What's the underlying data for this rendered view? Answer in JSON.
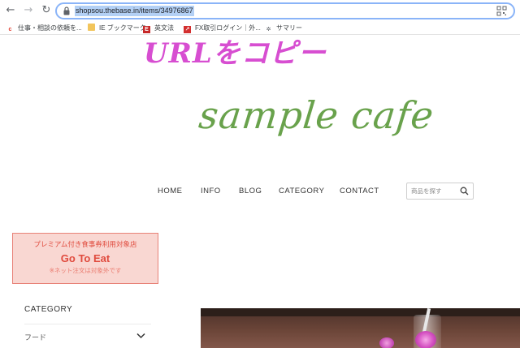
{
  "browser": {
    "url": "shopsou.thebase.in/items/34976867",
    "bookmarks": [
      {
        "label": "仕事・相談の依頼を...",
        "icon": "coconala-icon"
      },
      {
        "label": "IE ブックマーク",
        "icon": "folder-icon"
      },
      {
        "label": "英文法",
        "icon": "e-icon"
      },
      {
        "label": "FX取引ログイン｜外...",
        "icon": "fx-icon"
      },
      {
        "label": "サマリー",
        "icon": "gear-icon"
      }
    ]
  },
  "annotation": {
    "text": "URLをコピー",
    "color": "#d74ed1"
  },
  "site": {
    "logo": "sample cafe",
    "logo_color": "#69a24c",
    "nav": {
      "home": "HOME",
      "info": "INFO",
      "blog": "BLOG",
      "category": "CATEGORY",
      "contact": "CONTACT"
    },
    "search": {
      "placeholder": "商品を探す"
    }
  },
  "promo": {
    "line1": "プレミアム付き食事券利用対象店",
    "line2": "Go To Eat",
    "line3": "※ネット注文は対象外です",
    "accent": "#e04b3e"
  },
  "sidebar": {
    "heading": "CATEGORY",
    "items": [
      {
        "label": "フード"
      }
    ]
  }
}
